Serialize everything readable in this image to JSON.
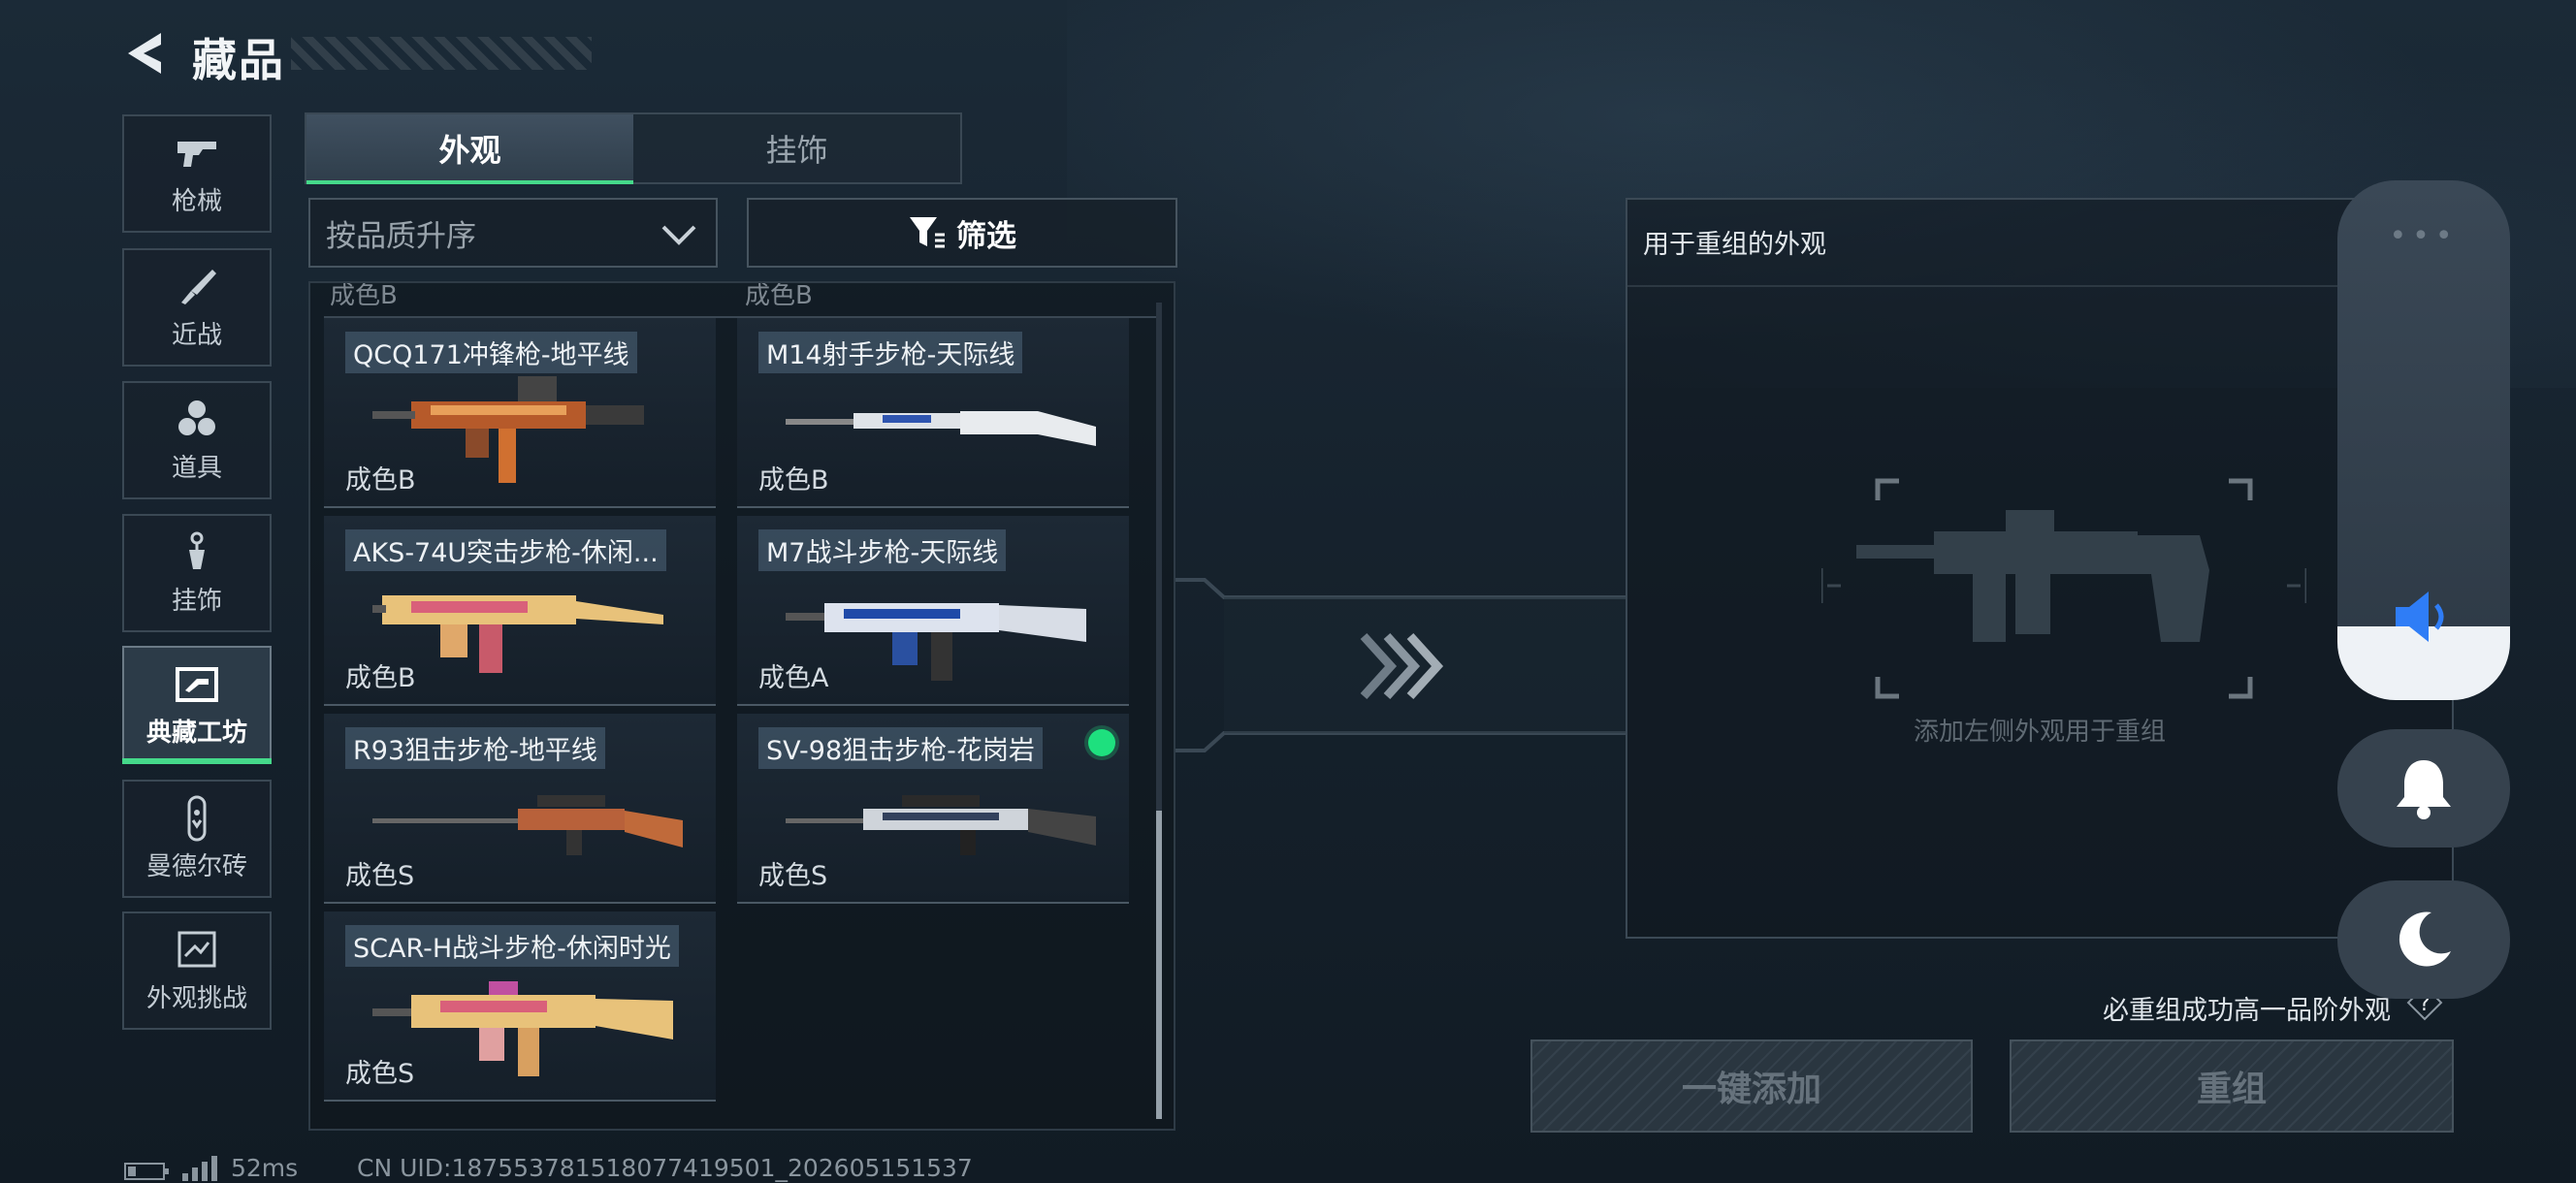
{
  "header": {
    "title": "藏品"
  },
  "nav": [
    {
      "label": "枪械",
      "icon": "gun-icon"
    },
    {
      "label": "近战",
      "icon": "knife-icon"
    },
    {
      "label": "道具",
      "icon": "grenade-icon"
    },
    {
      "label": "挂饰",
      "icon": "charm-icon"
    },
    {
      "label": "典藏工坊",
      "icon": "workshop-icon",
      "active": true
    },
    {
      "label": "曼德尔砖",
      "icon": "brick-icon"
    },
    {
      "label": "外观挑战",
      "icon": "challenge-icon"
    }
  ],
  "tabs": [
    {
      "label": "外观",
      "active": true
    },
    {
      "label": "挂饰",
      "active": false
    }
  ],
  "sort": {
    "value": "按品质升序"
  },
  "filter": {
    "label": "筛选"
  },
  "grid": {
    "cut_labels": [
      "成色B",
      "成色B"
    ],
    "items": [
      {
        "name": "QCQ171冲锋枪-地平线",
        "grade": "成色B",
        "owned": false
      },
      {
        "name": "M14射手步枪-天际线",
        "grade": "成色B",
        "owned": false
      },
      {
        "name": "AKS-74U突击步枪-休闲...",
        "grade": "成色B",
        "owned": false
      },
      {
        "name": "M7战斗步枪-天际线",
        "grade": "成色A",
        "owned": false
      },
      {
        "name": "R93狙击步枪-地平线",
        "grade": "成色S",
        "owned": false
      },
      {
        "name": "SV-98狙击步枪-花岗岩",
        "grade": "成色S",
        "owned": true
      },
      {
        "name": "SCAR-H战斗步枪-休闲时光",
        "grade": "成色S",
        "owned": false
      }
    ]
  },
  "recombine": {
    "title": "用于重组的外观",
    "hint": "添加左侧外观用于重组",
    "guarantee": "必重组成功高一品阶外观",
    "add_all_label": "一键添加",
    "recombine_label": "重组"
  },
  "status": {
    "ping": "52ms",
    "uid": "CN UID:187553781518077419501_202605151537"
  },
  "colors": {
    "accent": "#45d98a",
    "owned": "#1ee07e",
    "volume": "#2f7df6"
  }
}
